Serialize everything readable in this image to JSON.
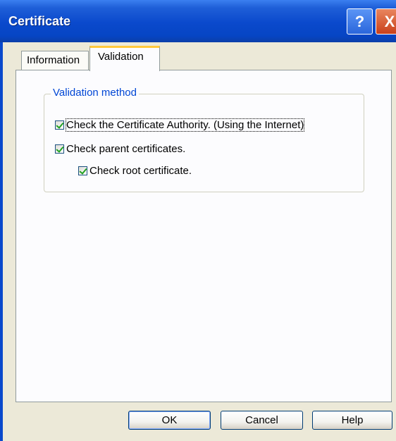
{
  "window": {
    "title": "Certificate",
    "help_glyph": "?",
    "close_glyph": "X"
  },
  "tabs": [
    {
      "label": "Information",
      "selected": false
    },
    {
      "label": "Validation",
      "selected": true
    }
  ],
  "validation": {
    "group_label": "Validation method",
    "options": [
      {
        "label": "Check the Certificate Authority. (Using the Internet)",
        "checked": true
      },
      {
        "label": "Check parent certificates.",
        "checked": true
      },
      {
        "label": "Check root certificate.",
        "checked": true
      }
    ]
  },
  "buttons": {
    "ok": "OK",
    "cancel": "Cancel",
    "help": "Help"
  },
  "colors": {
    "titlebar": "#0a49cc",
    "group_label": "#0046d5",
    "check": "#21a121"
  }
}
